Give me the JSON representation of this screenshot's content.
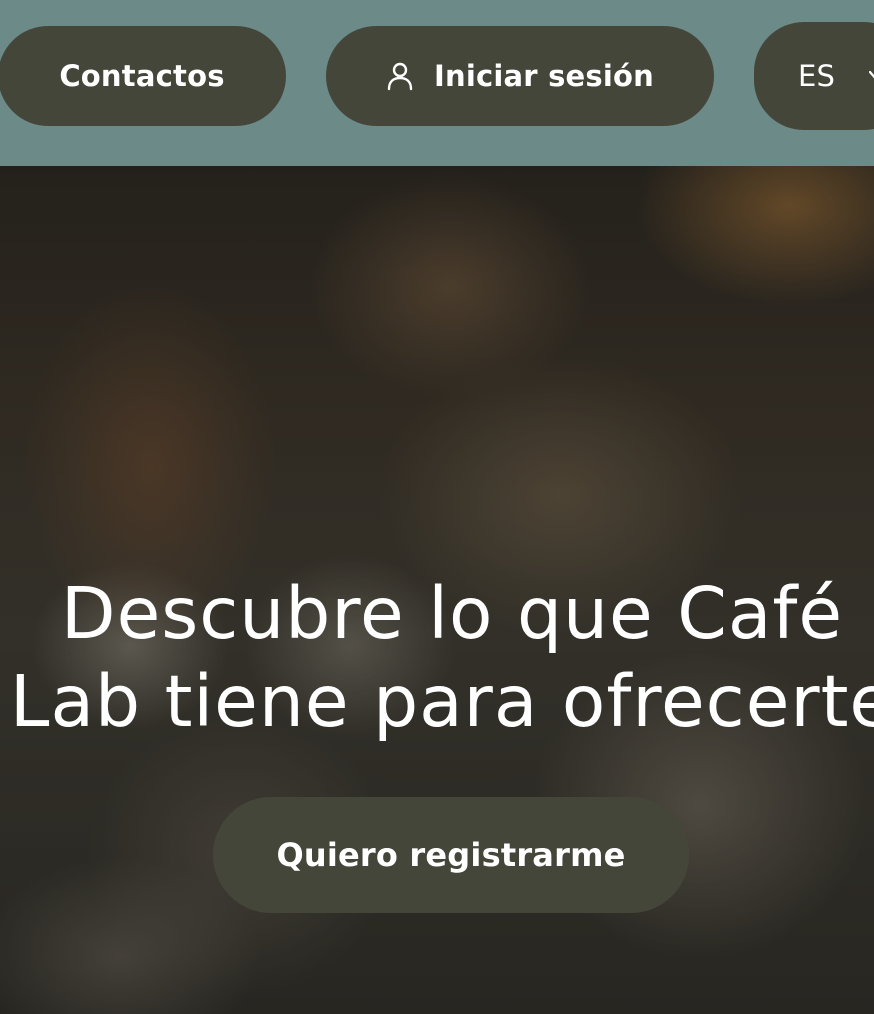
{
  "header": {
    "contacts_label": "Contactos",
    "login_label": "Iniciar sesión",
    "login_icon": "user-icon",
    "language": {
      "selected": "ES",
      "icon": "chevron-down-icon"
    }
  },
  "hero": {
    "title": "Descubre lo que Café Lab tiene para ofrecerte",
    "cta_label": "Quiero registrarme"
  },
  "colors": {
    "topbar": "#6b8a88",
    "button": "#45463a",
    "text": "#ffffff"
  }
}
